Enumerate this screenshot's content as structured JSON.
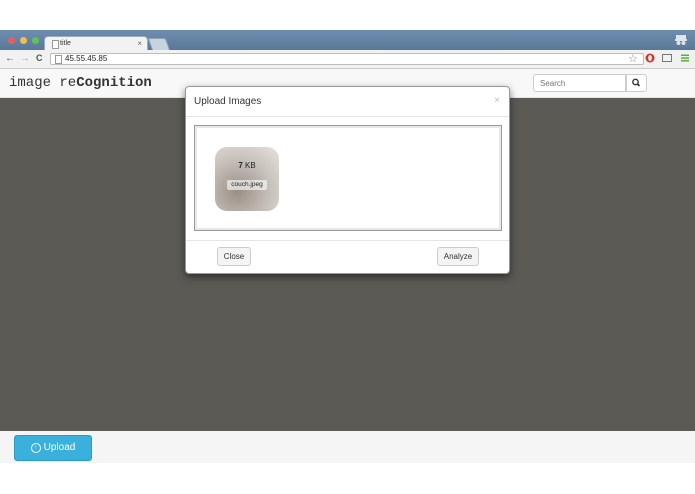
{
  "browser": {
    "tab_title": "title",
    "tab_close": "×",
    "url": "45.55.45.85",
    "back": "←",
    "forward": "→",
    "reload": "C"
  },
  "navbar": {
    "brand_plain": "image re",
    "brand_bold": "Cognition",
    "search_placeholder": "Search"
  },
  "modal": {
    "title": "Upload Images",
    "close_x": "×",
    "file": {
      "size_value": "7",
      "size_unit": " KB",
      "name": "couch.jpeg"
    },
    "close_button": "Close",
    "analyze_button": "Analyze"
  },
  "footer": {
    "upload_button": "Upload"
  },
  "colors": {
    "backdrop": "#5b5a55",
    "upload_button": "#3bb0dc"
  }
}
